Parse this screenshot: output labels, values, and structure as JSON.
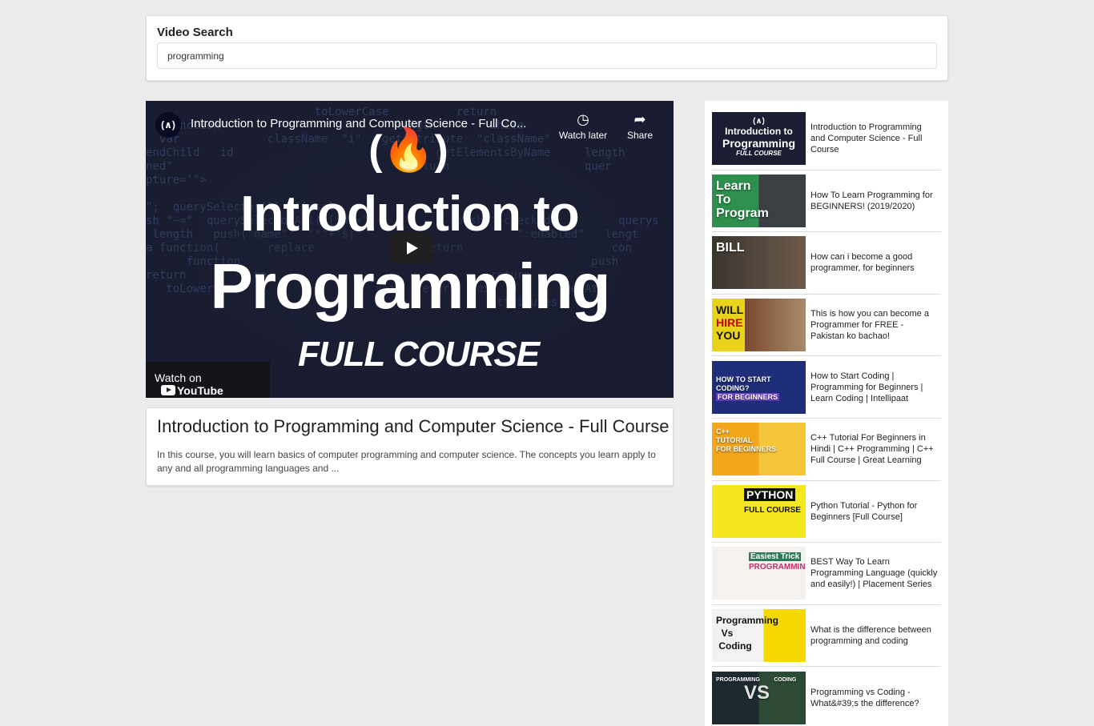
{
  "search": {
    "label": "Video Search",
    "value": "programming"
  },
  "player": {
    "channel_logo": "(∧)",
    "video_title": "Introduction to Programming and Computer Science - Full Co...",
    "watch_later_label": "Watch later",
    "share_label": "Share",
    "thumb_line1": "Introduction to",
    "thumb_line2": "Programming",
    "thumb_line3": "FULL COURSE",
    "watch_on_label": "Watch on",
    "youtube_label": "YouTube"
  },
  "selected": {
    "title": "Introduction to Programming and Computer Science - Full Course",
    "description": "In this course, you will learn basics of computer programming and computer science. The concepts you learn apply to any and all programming languages and ..."
  },
  "videos": [
    {
      "title": "Introduction to Programming and Computer Science - Full Course",
      "thumb_text": "Introduction to Programming FULL COURSE"
    },
    {
      "title": "How To Learn Programming for BEGINNERS! (2019/2020)",
      "thumb_text": "Learn To Program"
    },
    {
      "title": "How can i become a good programmer, for beginners",
      "thumb_text": "BILL"
    },
    {
      "title": "This is how you can become a Programmer for FREE - Pakistan ko bachao!",
      "thumb_text": "WILL HIRE YOU"
    },
    {
      "title": "How to Start Coding | Programming for Beginners | Learn Coding | Intellipaat",
      "thumb_text": "HOW TO START CODING? FOR BEGINNERS"
    },
    {
      "title": "C++ Tutorial For Beginners in Hindi | C++ Programming | C++ Full Course | Great Learning",
      "thumb_text": "C++ TUTORIAL FOR BEGINNERS"
    },
    {
      "title": "Python Tutorial - Python for Beginners [Full Course]",
      "thumb_text": "PYTHON FULL COURSE"
    },
    {
      "title": "BEST Way To Learn Programming Language (quickly and easily!) | Placement Series",
      "thumb_text": "Easiest Trick To Learn PROGRAMMING"
    },
    {
      "title": "What is the difference between programming and coding",
      "thumb_text": "Programming Vs Coding"
    },
    {
      "title": "Programming vs Coding - What&#39;s the difference?",
      "thumb_text": "PROGRAMMING VS CODING"
    }
  ],
  "colors": {
    "page_bg": "#ececec",
    "player_bg": "#1b1e33",
    "card_bg": "#ffffff"
  }
}
